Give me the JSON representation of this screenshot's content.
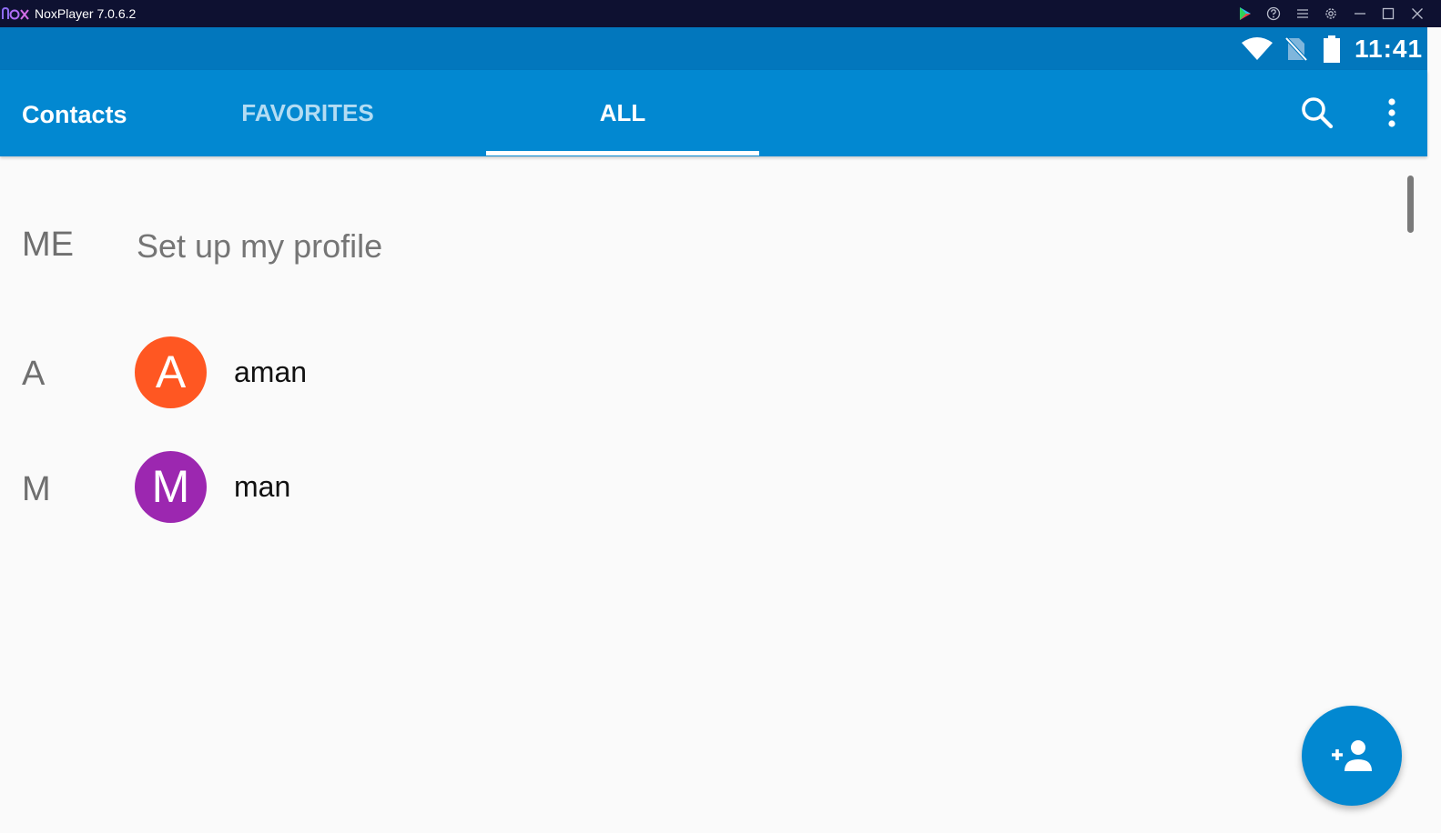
{
  "window": {
    "title": "NoxPlayer 7.0.6.2",
    "controls": [
      "play-store-icon",
      "help-icon",
      "menu-icon",
      "settings-icon",
      "minimize-icon",
      "maximize-icon",
      "close-icon"
    ]
  },
  "status_bar": {
    "time": "11:41",
    "icons": [
      "wifi-icon",
      "no-sim-icon",
      "battery-icon"
    ]
  },
  "app_bar": {
    "title": "Contacts",
    "tabs": [
      {
        "label": "FAVORITES",
        "selected": false
      },
      {
        "label": "ALL",
        "selected": true
      }
    ],
    "actions": [
      "search-icon",
      "more-vert-icon"
    ]
  },
  "list": {
    "me": {
      "section": "ME",
      "text": "Set up my profile"
    },
    "contacts": [
      {
        "section": "A",
        "initial": "A",
        "name": "aman",
        "avatar_color": "#ff5722"
      },
      {
        "section": "M",
        "initial": "M",
        "name": "man",
        "avatar_color": "#9c27b0"
      }
    ]
  },
  "fab": {
    "icon": "add-person-icon"
  },
  "colors": {
    "title_bar": "#0e1131",
    "status_bar": "#0277bd",
    "primary": "#0288d1",
    "background": "#fafafa"
  }
}
